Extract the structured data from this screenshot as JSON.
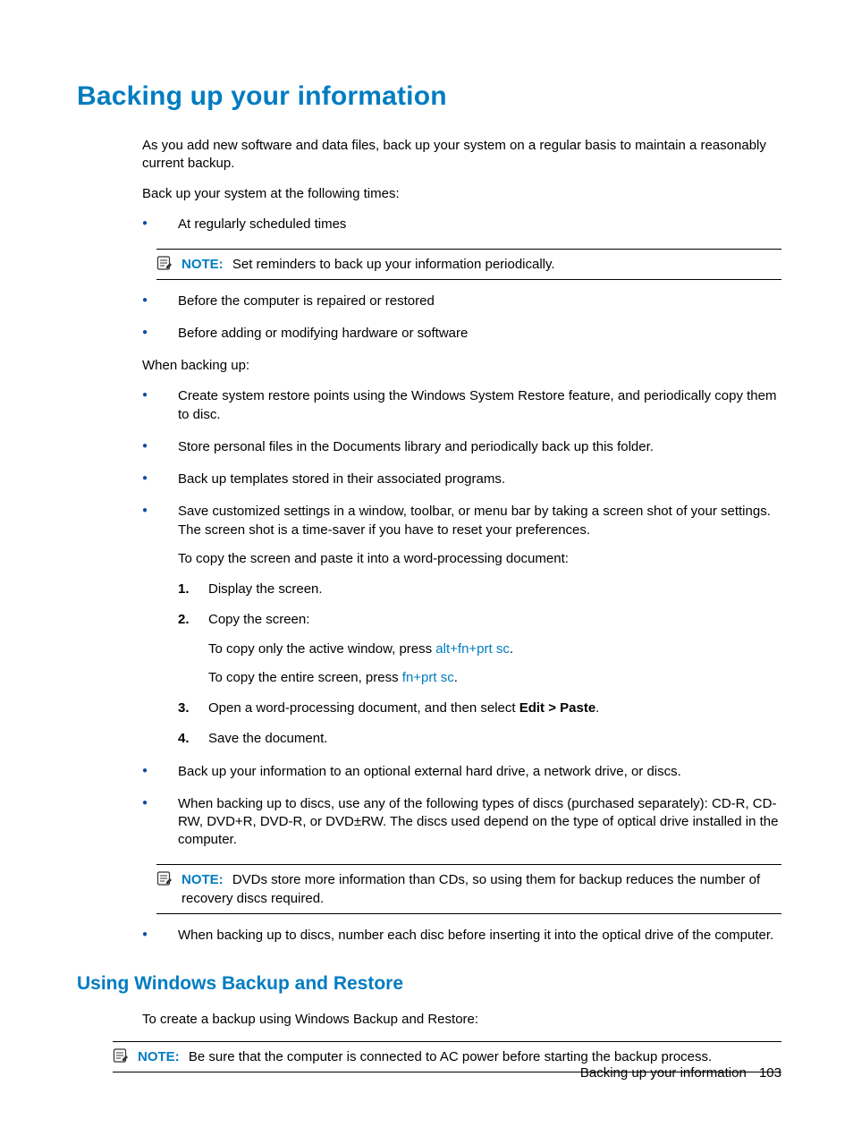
{
  "h1": "Backing up your information",
  "intro1": "As you add new software and data files, back up your system on a regular basis to maintain a reasonably current backup.",
  "intro2": "Back up your system at the following times:",
  "list1": {
    "item1": "At regularly scheduled times",
    "note1_label": "NOTE:",
    "note1_text": "Set reminders to back up your information periodically.",
    "item2": "Before the computer is repaired or restored",
    "item3": "Before adding or modifying hardware or software"
  },
  "when_backing_up": "When backing up:",
  "list2": {
    "item1": "Create system restore points using the Windows System Restore feature, and periodically copy them to disc.",
    "item2": "Store personal files in the Documents library and periodically back up this folder.",
    "item3": "Back up templates stored in their associated programs.",
    "item4": "Save customized settings in a window, toolbar, or menu bar by taking a screen shot of your settings. The screen shot is a time-saver if you have to reset your preferences.",
    "item4_sub": "To copy the screen and paste it into a word-processing document:",
    "steps": {
      "n1": "1.",
      "s1": "Display the screen.",
      "n2": "2.",
      "s2": "Copy the screen:",
      "s2a_pre": "To copy only the active window, press ",
      "s2a_key": "alt+fn+prt sc",
      "s2a_post": ".",
      "s2b_pre": "To copy the entire screen, press ",
      "s2b_key": "fn+prt sc",
      "s2b_post": ".",
      "n3": "3.",
      "s3_pre": "Open a word-processing document, and then select ",
      "s3_bold": "Edit > Paste",
      "s3_post": ".",
      "n4": "4.",
      "s4": "Save the document."
    },
    "item5": "Back up your information to an optional external hard drive, a network drive, or discs.",
    "item6": "When backing up to discs, use any of the following types of discs (purchased separately): CD-R, CD-RW, DVD+R, DVD-R, or DVD±RW. The discs used depend on the type of optical drive installed in the computer.",
    "note2_label": "NOTE:",
    "note2_text": "DVDs store more information than CDs, so using them for backup reduces the number of recovery discs required.",
    "item7": "When backing up to discs, number each disc before inserting it into the optical drive of the computer."
  },
  "h2": "Using Windows Backup and Restore",
  "sub_intro": "To create a backup using Windows Backup and Restore:",
  "note3_label": "NOTE:",
  "note3_text": "Be sure that the computer is connected to AC power before starting the backup process.",
  "footer_text": "Backing up your information",
  "footer_page": "103"
}
